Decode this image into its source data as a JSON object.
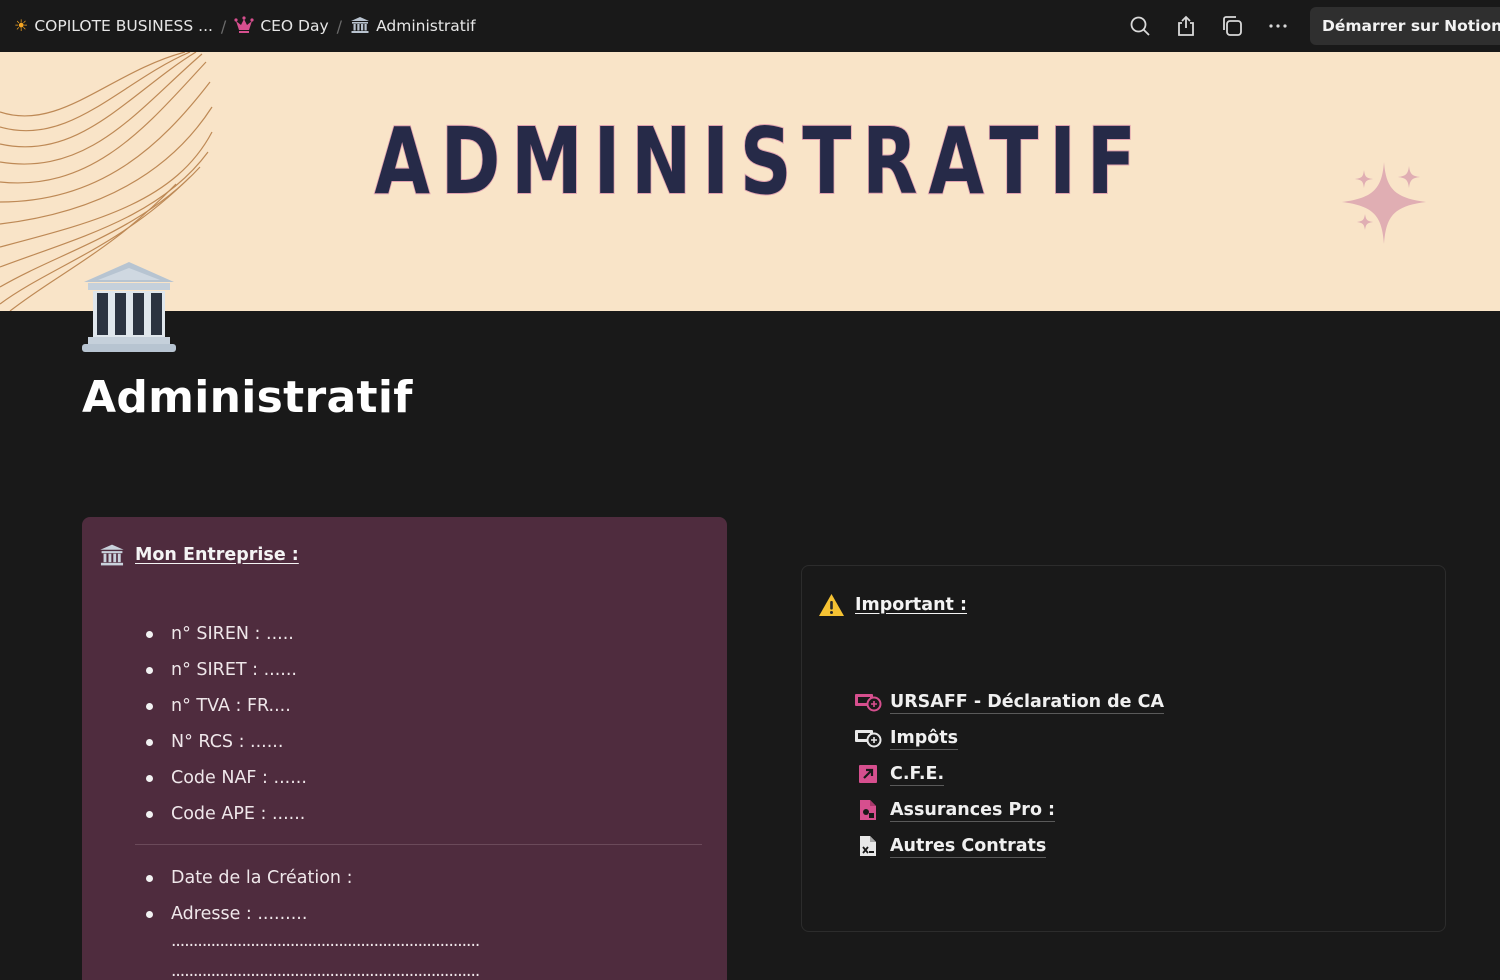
{
  "breadcrumb": [
    {
      "icon": "sun-icon",
      "label": "COPILOTE BUSINESS ..."
    },
    {
      "icon": "crown-icon",
      "label": "CEO Day"
    },
    {
      "icon": "classical-building-icon",
      "label": "Administratif"
    }
  ],
  "topbar": {
    "cta_label": "Démarrer sur Notion ma"
  },
  "cover": {
    "title": "ADMINISTRATIF"
  },
  "page": {
    "title": "Administratif",
    "icon": "classical-building-icon"
  },
  "entreprise": {
    "heading": "Mon Entreprise :",
    "icon": "classical-building-icon",
    "items": [
      " n° SIREN : .....",
      "n° SIRET : ......",
      "n° TVA : FR....",
      "N° RCS : ......",
      "Code NAF : ......",
      "Code APE : ......"
    ],
    "items2": [
      "Date de la Création :",
      "Adresse : ........."
    ],
    "dotted_lines": [
      "......................................................................",
      "......................................................................"
    ]
  },
  "important": {
    "heading": "Important :",
    "icon": "warning-icon",
    "links": [
      {
        "label": "URSAFF - Déclaration de CA",
        "icon": "money-exchange-icon"
      },
      {
        "label": "Impôts",
        "icon": "money-exchange-icon"
      },
      {
        "label": "C.F.E.",
        "icon": "arrow-box-icon"
      },
      {
        "label": "Assurances Pro :",
        "icon": "document-shapes-icon"
      },
      {
        "label": "Autres Contrats",
        "icon": "document-x-icon"
      }
    ]
  },
  "colors": {
    "accent_pink": "#d64f8e",
    "cover_bg": "#f9e4c8",
    "cover_text": "#262a48",
    "callout_bg": "#4f2c3e"
  }
}
